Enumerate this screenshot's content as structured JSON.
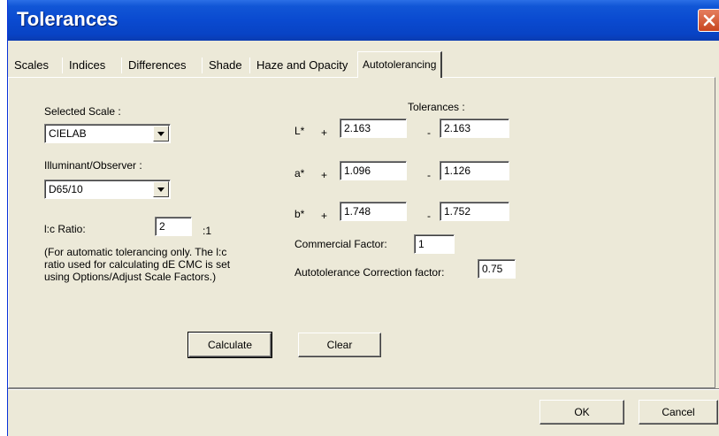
{
  "window": {
    "title": "Tolerances"
  },
  "tabs": [
    {
      "label": "Scales"
    },
    {
      "label": "Indices"
    },
    {
      "label": "Differences"
    },
    {
      "label": "Shade"
    },
    {
      "label": "Haze and Opacity"
    },
    {
      "label": "Autotolerancing"
    }
  ],
  "active_tab": "Autotolerancing",
  "left": {
    "selected_scale_label": "Selected Scale :",
    "selected_scale_value": "CIELAB",
    "illuminant_label": "Illuminant/Observer :",
    "illuminant_value": "D65/10",
    "lc_ratio_label": "l:c Ratio:",
    "lc_ratio_value": "2",
    "lc_ratio_suffix": ":1",
    "note": "(For automatic tolerancing only.  The l:c\nratio used for calculating dE CMC is set\nusing Options/Adjust Scale Factors.)"
  },
  "tolerances": {
    "header": "Tolerances :",
    "plus_sign": "+",
    "minus_sign": "-",
    "rows": [
      {
        "label": "L*",
        "plus": "2.163",
        "minus": "2.163"
      },
      {
        "label": "a*",
        "plus": "1.096",
        "minus": "1.126"
      },
      {
        "label": "b*",
        "plus": "1.748",
        "minus": "1.752"
      }
    ],
    "commercial_factor_label": "Commercial Factor:",
    "commercial_factor_value": "1",
    "correction_label": "Autotolerance Correction factor:",
    "correction_value": "0.75"
  },
  "buttons": {
    "calculate": "Calculate",
    "clear": "Clear",
    "ok": "OK",
    "cancel": "Cancel"
  },
  "colors": {
    "titlebar": "#0a4ad0",
    "close_button": "#d4532a",
    "window_bg": "#ece9d8"
  },
  "icons": {
    "close": "close-icon",
    "dropdown": "chevron-down-icon"
  }
}
